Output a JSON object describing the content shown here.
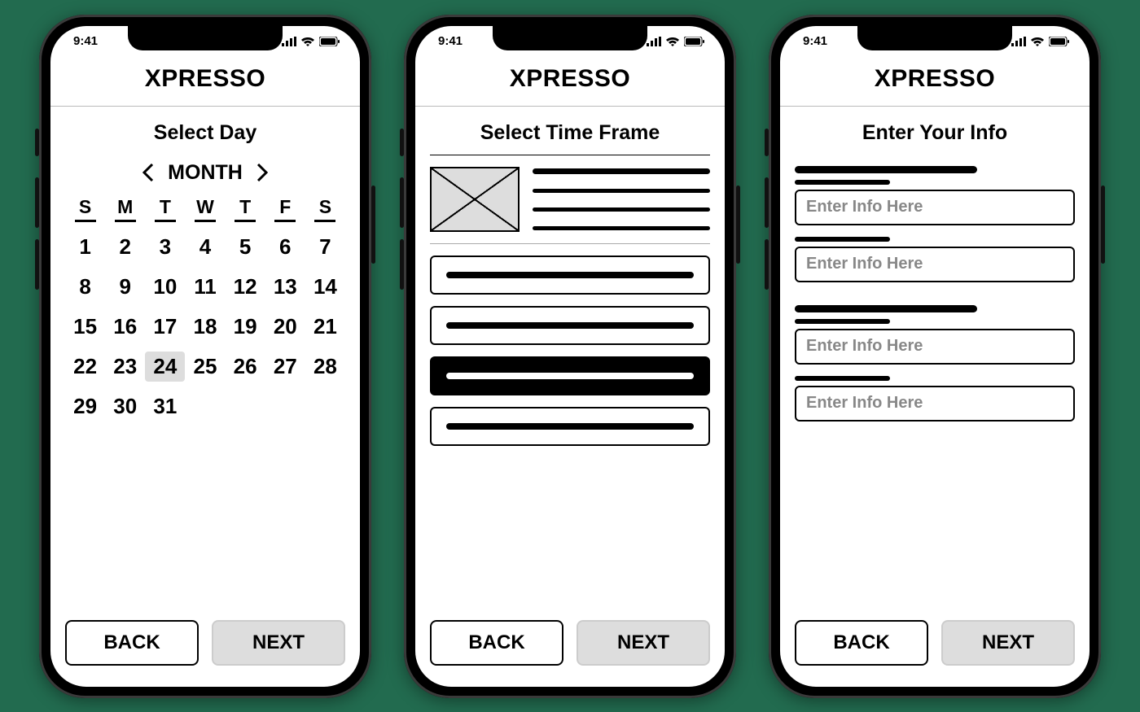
{
  "status_time": "9:41",
  "app_title": "XPRESSO",
  "buttons": {
    "back": "BACK",
    "next": "NEXT"
  },
  "screen1": {
    "title": "Select Day",
    "month_label": "MONTH",
    "dow": [
      "S",
      "M",
      "T",
      "W",
      "T",
      "F",
      "S"
    ],
    "days": [
      1,
      2,
      3,
      4,
      5,
      6,
      7,
      8,
      9,
      10,
      11,
      12,
      13,
      14,
      15,
      16,
      17,
      18,
      19,
      20,
      21,
      22,
      23,
      24,
      25,
      26,
      27,
      28,
      29,
      30,
      31
    ],
    "selected": 24
  },
  "screen2": {
    "title": "Select Time Frame",
    "options": [
      {
        "selected": false
      },
      {
        "selected": false
      },
      {
        "selected": true
      },
      {
        "selected": false
      }
    ]
  },
  "screen3": {
    "title": "Enter Your Info",
    "placeholder": "Enter Info Here"
  }
}
